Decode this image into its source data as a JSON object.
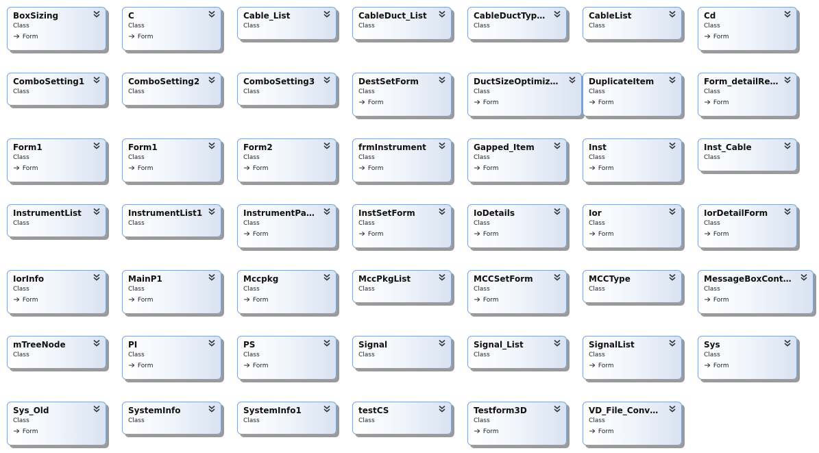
{
  "classes": [
    {
      "name": "BoxSizing",
      "stereotype": "Class",
      "base": "Form"
    },
    {
      "name": "C",
      "stereotype": "Class",
      "base": "Form"
    },
    {
      "name": "Cable_List",
      "stereotype": "Class",
      "base": ""
    },
    {
      "name": "CableDuct_List",
      "stereotype": "Class",
      "base": ""
    },
    {
      "name": "CableDuctTypeL...",
      "stereotype": "Class",
      "base": ""
    },
    {
      "name": "CableList",
      "stereotype": "Class",
      "base": ""
    },
    {
      "name": "Cd",
      "stereotype": "Class",
      "base": "Form"
    },
    {
      "name": "ComboSetting1",
      "stereotype": "Class",
      "base": ""
    },
    {
      "name": "ComboSetting2",
      "stereotype": "Class",
      "base": ""
    },
    {
      "name": "ComboSetting3",
      "stereotype": "Class",
      "base": ""
    },
    {
      "name": "DestSetForm",
      "stereotype": "Class",
      "base": "Form"
    },
    {
      "name": "DuctSizeOptimization",
      "stereotype": "Class",
      "base": "Form"
    },
    {
      "name": "DuplicateItem",
      "stereotype": "Class",
      "base": "Form"
    },
    {
      "name": "Form_detailResult",
      "stereotype": "Class",
      "base": "Form"
    },
    {
      "name": "Form1",
      "stereotype": "Class",
      "base": "Form"
    },
    {
      "name": "Form1",
      "stereotype": "Class",
      "base": "Form"
    },
    {
      "name": "Form2",
      "stereotype": "Class",
      "base": "Form"
    },
    {
      "name": "frmInstrument",
      "stereotype": "Class",
      "base": "Form"
    },
    {
      "name": "Gapped_Item",
      "stereotype": "Class",
      "base": "Form"
    },
    {
      "name": "Inst",
      "stereotype": "Class",
      "base": "Form"
    },
    {
      "name": "Inst_Cable",
      "stereotype": "Class",
      "base": ""
    },
    {
      "name": "InstrumentList",
      "stereotype": "Class",
      "base": ""
    },
    {
      "name": "InstrumentList1",
      "stereotype": "Class",
      "base": ""
    },
    {
      "name": "InstrumentPara...",
      "stereotype": "Class",
      "base": "Form"
    },
    {
      "name": "InstSetForm",
      "stereotype": "Class",
      "base": "Form"
    },
    {
      "name": "IoDetails",
      "stereotype": "Class",
      "base": "Form"
    },
    {
      "name": "Ior",
      "stereotype": "Class",
      "base": "Form"
    },
    {
      "name": "IorDetailForm",
      "stereotype": "Class",
      "base": "Form"
    },
    {
      "name": "IorInfo",
      "stereotype": "Class",
      "base": "Form"
    },
    {
      "name": "MainP1",
      "stereotype": "Class",
      "base": "Form"
    },
    {
      "name": "Mccpkg",
      "stereotype": "Class",
      "base": "Form"
    },
    {
      "name": "MccPkgList",
      "stereotype": "Class",
      "base": ""
    },
    {
      "name": "MCCSetForm",
      "stereotype": "Class",
      "base": "Form"
    },
    {
      "name": "MCCType",
      "stereotype": "Class",
      "base": ""
    },
    {
      "name": "MessageBoxControl",
      "stereotype": "Class",
      "base": "Form"
    },
    {
      "name": "mTreeNode",
      "stereotype": "Class",
      "base": ""
    },
    {
      "name": "PI",
      "stereotype": "Class",
      "base": "Form"
    },
    {
      "name": "PS",
      "stereotype": "Class",
      "base": "Form"
    },
    {
      "name": "Signal",
      "stereotype": "Class",
      "base": ""
    },
    {
      "name": "Signal_List",
      "stereotype": "Class",
      "base": ""
    },
    {
      "name": "SignalList",
      "stereotype": "Class",
      "base": "Form"
    },
    {
      "name": "Sys",
      "stereotype": "Class",
      "base": "Form"
    },
    {
      "name": "Sys_Old",
      "stereotype": "Class",
      "base": "Form"
    },
    {
      "name": "SystemInfo",
      "stereotype": "Class",
      "base": ""
    },
    {
      "name": "SystemInfo1",
      "stereotype": "Class",
      "base": ""
    },
    {
      "name": "testCS",
      "stereotype": "Class",
      "base": ""
    },
    {
      "name": "Testform3D",
      "stereotype": "Class",
      "base": "Form"
    },
    {
      "name": "VD_File_Converter",
      "stereotype": "Class",
      "base": "Form"
    }
  ],
  "colors": {
    "border": "#7ea3d4",
    "shadow": "#9a9a9a",
    "gradient_end": "#d9e3f2"
  },
  "icons": {
    "collapse": "double-chevron-down-icon",
    "inherit": "inheritance-arrow-icon"
  }
}
